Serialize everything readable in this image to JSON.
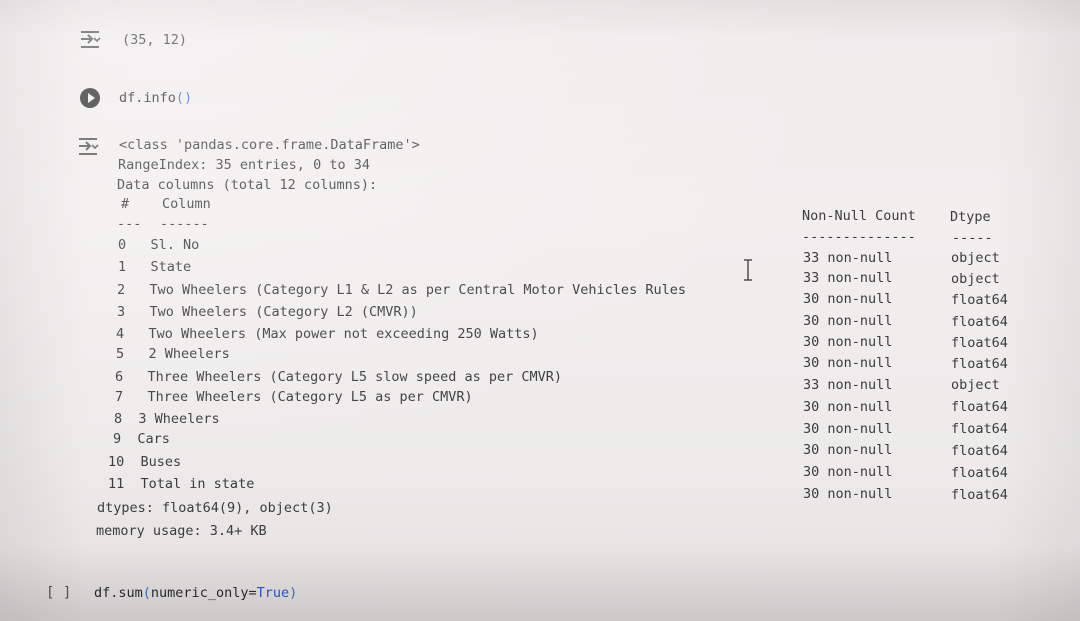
{
  "cell_shape": {
    "output": "(35, 12)"
  },
  "cell_info": {
    "code_fn": "df.info",
    "code_parens": "()",
    "output": {
      "class_line": "<class 'pandas.core.frame.DataFrame'>",
      "range_index": "RangeIndex: 35 entries, 0 to 34",
      "data_columns": "Data columns (total 12 columns):",
      "header_num": "#",
      "header_column": "Column",
      "header_nonnull": "Non-Null Count",
      "header_dtype": "Dtype",
      "sep_num": "---",
      "sep_column": "------",
      "sep_nonnull": "--------------",
      "sep_dtype": "-----",
      "columns": [
        {
          "idx": "0",
          "name": "Sl. No",
          "nonnull": "33 non-null",
          "dtype": "object"
        },
        {
          "idx": "1",
          "name": "State",
          "nonnull": "33 non-null",
          "dtype": "object"
        },
        {
          "idx": "2",
          "name": "Two Wheelers (Category L1 & L2 as per Central Motor Vehicles Rules",
          "nonnull": "30 non-null",
          "dtype": "float64"
        },
        {
          "idx": "3",
          "name": "Two Wheelers (Category L2 (CMVR))",
          "nonnull": "30 non-null",
          "dtype": "float64"
        },
        {
          "idx": "4",
          "name": "Two Wheelers (Max power not exceeding 250 Watts)",
          "nonnull": "30 non-null",
          "dtype": "float64"
        },
        {
          "idx": "5",
          "name": "2 Wheelers",
          "nonnull": "30 non-null",
          "dtype": "float64"
        },
        {
          "idx": "6",
          "name": "Three Wheelers (Category L5 slow speed as per CMVR)",
          "nonnull": "33 non-null",
          "dtype": "object"
        },
        {
          "idx": "7",
          "name": "Three Wheelers (Category L5 as per CMVR)",
          "nonnull": "30 non-null",
          "dtype": "float64"
        },
        {
          "idx": "8",
          "name": "3 Wheelers",
          "nonnull": "30 non-null",
          "dtype": "float64"
        },
        {
          "idx": "9",
          "name": "Cars",
          "nonnull": "30 non-null",
          "dtype": "float64"
        },
        {
          "idx": "10",
          "name": "Buses",
          "nonnull": "30 non-null",
          "dtype": "float64"
        },
        {
          "idx": "11",
          "name": "Total in state",
          "nonnull": "30 non-null",
          "dtype": "float64"
        }
      ],
      "dtypes_line": "dtypes: float64(9), object(3)",
      "memory_line": "memory usage: 3.4+ KB"
    }
  },
  "cell_sum": {
    "prompt": "[ ]",
    "code_prefix": "df.",
    "code_fn": "sum",
    "code_open": "(",
    "code_arg": "numeric_only=",
    "code_kw": "True",
    "code_close": ")"
  },
  "icons": {
    "output": "output-toggle-icon",
    "run": "run-cell-icon",
    "cursor": "text-cursor-icon"
  },
  "colors": {
    "paren": "#3a6fd0",
    "keyword": "#2f55c9",
    "text": "#3b3b40"
  }
}
